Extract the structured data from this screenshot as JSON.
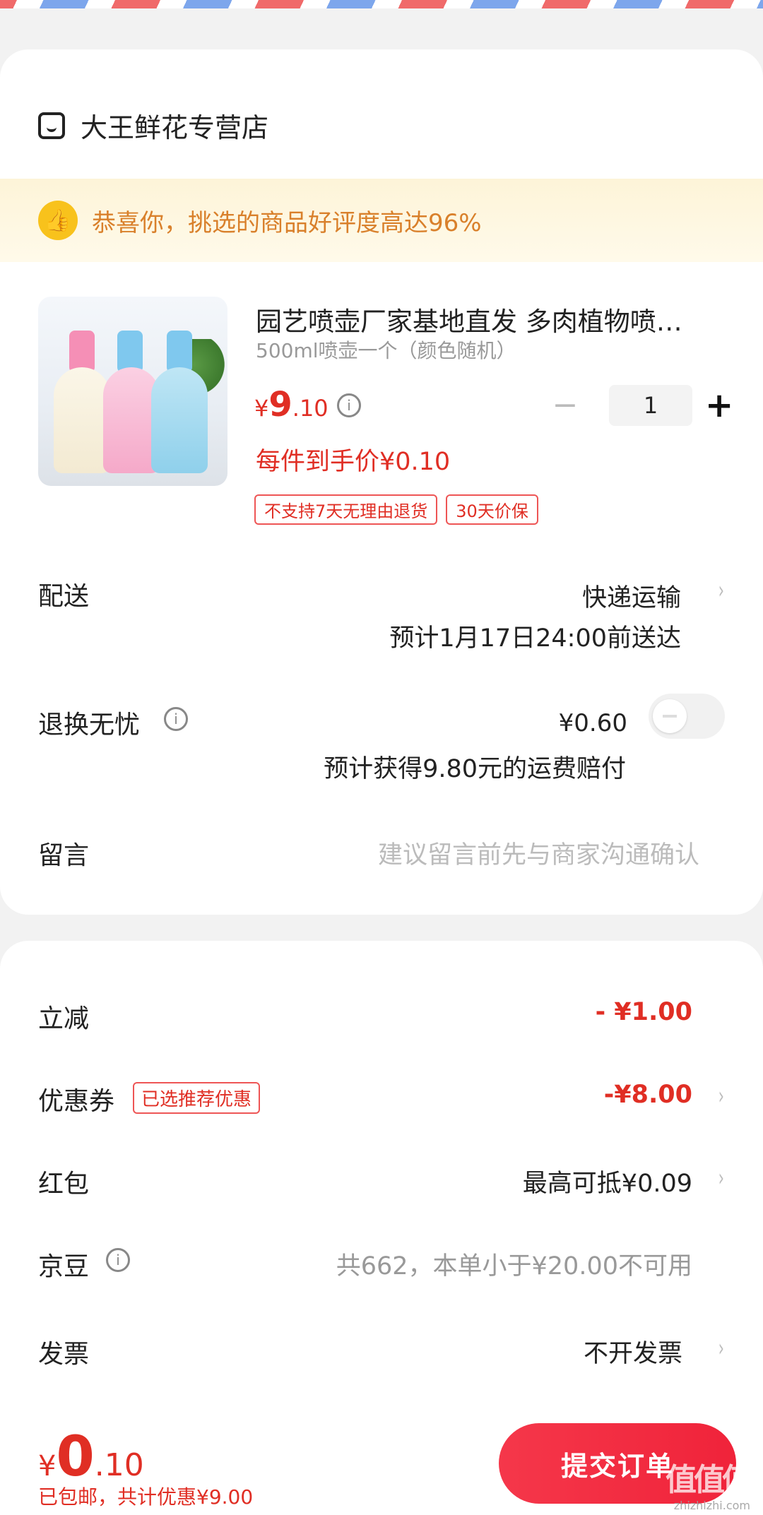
{
  "shop": {
    "name": "大王鲜花专营店",
    "icon": "shop-icon"
  },
  "banner": {
    "text": "恭喜你，挑选的商品好评度高达96%",
    "icon": "thumbs-up-icon"
  },
  "product": {
    "title": "园艺喷壶厂家基地直发 多肉植物喷…",
    "spec": "500ml喷壶一个（颜色随机）",
    "price_symbol": "¥",
    "price_int": "9",
    "price_dec": ".10",
    "quantity": "1",
    "deal_price": "每件到手价¥0.10",
    "tags": [
      "不支持7天无理由退货",
      "30天价保"
    ]
  },
  "delivery": {
    "label": "配送",
    "method": "快递运输",
    "eta": "预计1月17日24:00前送达"
  },
  "return_guarantee": {
    "label": "退换无忧",
    "price": "¥0.60",
    "note": "预计获得9.80元的运费赔付",
    "enabled": false
  },
  "message": {
    "label": "留言",
    "placeholder": "建议留言前先与商家沟通确认"
  },
  "discounts": {
    "instant": {
      "label": "立减",
      "value": "- ¥1.00"
    },
    "coupon": {
      "label": "优惠券",
      "badge": "已选推荐优惠",
      "value": "-¥8.00"
    },
    "red_packet": {
      "label": "红包",
      "value": "最高可抵¥0.09"
    },
    "jingdou": {
      "label": "京豆",
      "value": "共662，本单小于¥20.00不可用"
    },
    "invoice": {
      "label": "发票",
      "value": "不开发票"
    }
  },
  "footer": {
    "total_symbol": "¥",
    "total_int": "0",
    "total_dec": ".10",
    "note": "已包邮，共计优惠¥9.00",
    "submit_label": "提交订单",
    "watermark": "值值值",
    "watermark_url": "zhizhizhi.com"
  },
  "colors": {
    "accent": "#e02e24",
    "button": "#f0233a",
    "banner_bg": "#fdf4d8",
    "banner_text": "#d9802b"
  }
}
